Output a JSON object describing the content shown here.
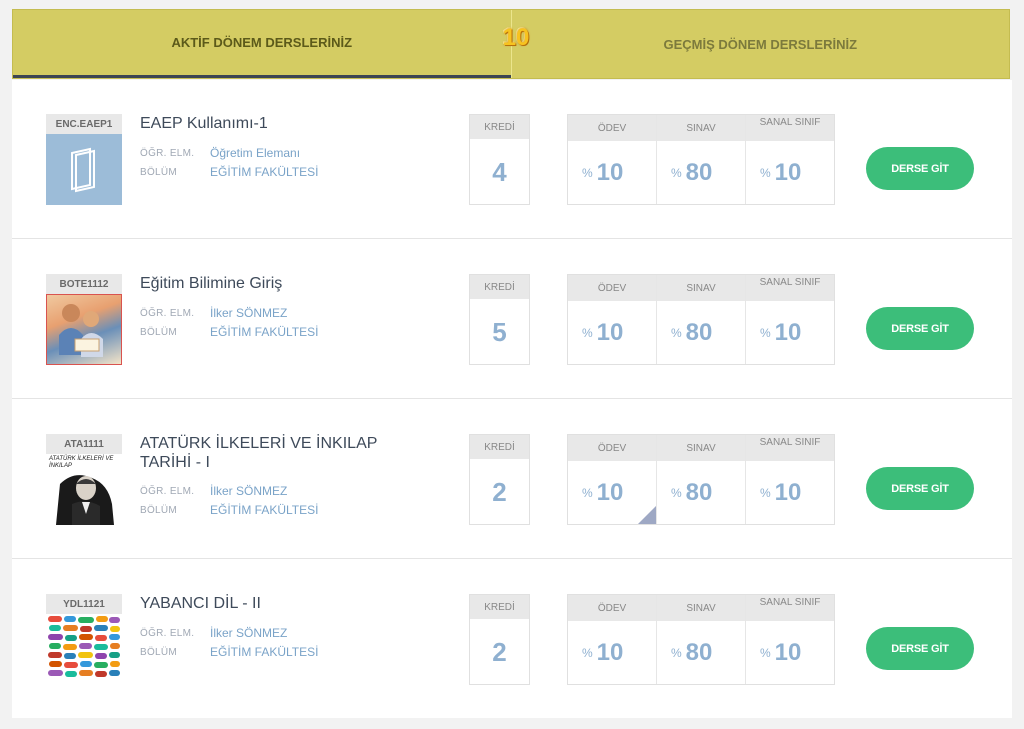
{
  "tabs": {
    "active_label": "AKTİF DÖNEM DERSLERİNİZ",
    "badge": "10",
    "inactive_label": "GEÇMİŞ DÖNEM DERSLERİNİZ"
  },
  "labels": {
    "instructor": "ÖĞR. ELM.",
    "department": "BÖLÜM",
    "credit": "KREDİ",
    "homework": "ÖDEV",
    "exam": "SINAV",
    "virtual_class": "SANAL SINIF",
    "percent": "%",
    "go_button": "DERSE GİT"
  },
  "colors": {
    "tab_bar": "#d4cc63",
    "accent_button": "#3cbe7a",
    "value_blue": "#8fb0d0"
  },
  "courses": [
    {
      "code": "ENC.EAEP1",
      "thumbnail": "book-icon",
      "title": "EAEP Kullanımı-1",
      "instructor": "Öğretim Elemanı",
      "department": "EĞİTİM FAKÜLTESİ",
      "credit": "4",
      "homework": "10",
      "exam": "80",
      "virtual_class": "10"
    },
    {
      "code": "BOTE1112",
      "thumbnail": "reading-children-photo",
      "title": "Eğitim Bilimine Giriş",
      "instructor": "İlker SÖNMEZ",
      "department": "EĞİTİM FAKÜLTESİ",
      "credit": "5",
      "homework": "10",
      "exam": "80",
      "virtual_class": "10"
    },
    {
      "code": "ATA1111",
      "thumbnail": "ataturk-portrait",
      "thumb_caption": "ATATÜRK İLKELERİ VE İNKILAP",
      "title": "ATATÜRK İLKELERİ VE İNKILAP TARİHİ - I",
      "instructor": "İlker SÖNMEZ",
      "department": "EĞİTİM FAKÜLTESİ",
      "credit": "2",
      "homework": "10",
      "exam": "80",
      "virtual_class": "10"
    },
    {
      "code": "YDL1121",
      "thumbnail": "speech-bubbles-words",
      "title": "YABANCI DİL - II",
      "instructor": "İlker SÖNMEZ",
      "department": "EĞİTİM FAKÜLTESİ",
      "credit": "2",
      "homework": "10",
      "exam": "80",
      "virtual_class": "10"
    }
  ]
}
